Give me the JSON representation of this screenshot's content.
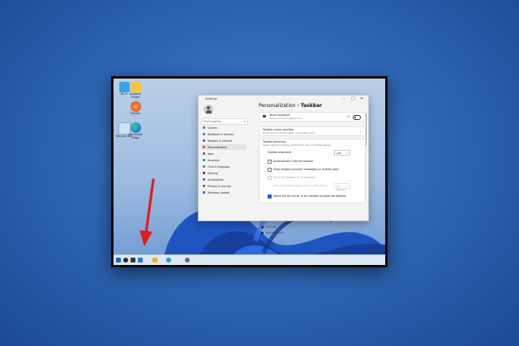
{
  "desktop": {
    "icons": [
      "Wi-Fi",
      "Explorer Folder",
      "Firefox",
      "Recycle Bin",
      "Microsoft Edge"
    ]
  },
  "settings": {
    "window_title": "Settings",
    "controls": [
      "–",
      "□",
      "✕"
    ],
    "search_placeholder": "Find a setting",
    "nav": [
      {
        "label": "System",
        "color": "#3b78d8"
      },
      {
        "label": "Bluetooth & devices",
        "color": "#3b78d8"
      },
      {
        "label": "Network & internet",
        "color": "#2d6fd6"
      },
      {
        "label": "Personalization",
        "color": "#c25c2e",
        "active": true
      },
      {
        "label": "Apps",
        "color": "#5b6a7b"
      },
      {
        "label": "Accounts",
        "color": "#2a9a6a"
      },
      {
        "label": "Time & language",
        "color": "#3b78d8"
      },
      {
        "label": "Gaming",
        "color": "#4a4a4a"
      },
      {
        "label": "Accessibility",
        "color": "#3b78d8"
      },
      {
        "label": "Privacy & security",
        "color": "#666666"
      },
      {
        "label": "Windows Update",
        "color": "#2d6fd6"
      }
    ],
    "breadcrumb_parent": "Personalization",
    "breadcrumb_sep": "›",
    "breadcrumb_current": "Taskbar",
    "touch_keyboard": {
      "title": "Touch keyboard",
      "sub": "Always show touch keyboard icon",
      "toggle": "Off"
    },
    "corner_overflow": {
      "title": "Taskbar corner overflow",
      "sub": "Choose which icons may appear in the taskbar corner"
    },
    "behaviors": {
      "title": "Taskbar behaviors",
      "sub": "Taskbar alignment, badging, automatically hide, and multiple displays",
      "alignment_label": "Taskbar alignment",
      "alignment_value": "Left",
      "auto_hide": "Automatically hide the taskbar",
      "badges": "Show badges (counter) messages on taskbar apps",
      "all_displays": "Show my taskbar on all displays",
      "multi_display": "When using multiple displays, show my taskbar apps on",
      "multi_display_value": "All taskbars",
      "far_corner": "Select the far corner of the taskbar to show the desktop"
    },
    "links": [
      "Get help",
      "Give feedback"
    ]
  },
  "taskbar": {
    "icons": [
      "start-icon",
      "search-icon",
      "task-view-icon",
      "widgets-icon",
      "file-explorer-icon",
      "edge-icon",
      "settings-icon"
    ]
  },
  "colors": {
    "accent": "#1d64c8",
    "arrow": "#e11d1d"
  }
}
